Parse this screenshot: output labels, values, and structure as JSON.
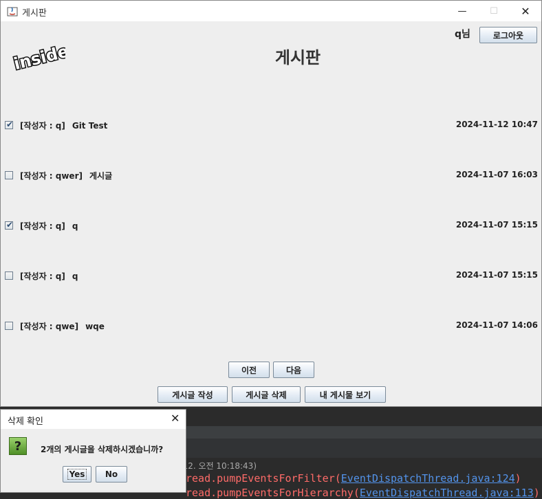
{
  "window": {
    "title": "게시판",
    "controls": {
      "minimize": "—",
      "maximize": "☐",
      "close": "✕"
    }
  },
  "header": {
    "user_label": "q님",
    "logout_label": "로그아웃",
    "logo_text": "inside",
    "board_title": "게시판"
  },
  "posts": [
    {
      "checked": true,
      "author": "[작성자 : q]",
      "title": "Git Test",
      "date": "2024-11-12 10:47"
    },
    {
      "checked": false,
      "author": "[작성자 : qwer]",
      "title": "게시글",
      "date": "2024-11-07 16:03"
    },
    {
      "checked": true,
      "author": "[작성자 : q]",
      "title": "q",
      "date": "2024-11-07 15:15"
    },
    {
      "checked": false,
      "author": "[작성자 : q]",
      "title": "q",
      "date": "2024-11-07 15:15"
    },
    {
      "checked": false,
      "author": "[작성자 : qwe]",
      "title": "wqe",
      "date": "2024-11-07 14:06"
    }
  ],
  "pagination": {
    "prev_label": "이전",
    "next_label": "다음"
  },
  "actions": {
    "write_label": "게시글 작성",
    "delete_label": "게시글 삭제",
    "my_posts_label": "내 게시물 보기"
  },
  "dialog": {
    "title": "삭제 확인",
    "close": "✕",
    "icon": "?",
    "message": "2개의 게시글을 삭제하시겠습니까?",
    "yes_label": "Yes",
    "no_label": "No"
  },
  "background_console": {
    "timestamp": ". 12. 오전 10:18:43)",
    "line1_prefix": "read.pumpEventsForFilter(",
    "line1_link": "EventDispatchThread.java:124",
    "line1_suffix": ")",
    "line2_prefix": "read.pumpEventsForHierarchy(",
    "line2_link": "EventDispatchThread.java:113",
    "line2_suffix": ")"
  },
  "colors": {
    "window_bg": "#eeeeee",
    "console_bg": "#2b2b2b",
    "console_error": "#ff6b68",
    "console_link": "#5394ec",
    "question_icon": "#6fb040"
  }
}
